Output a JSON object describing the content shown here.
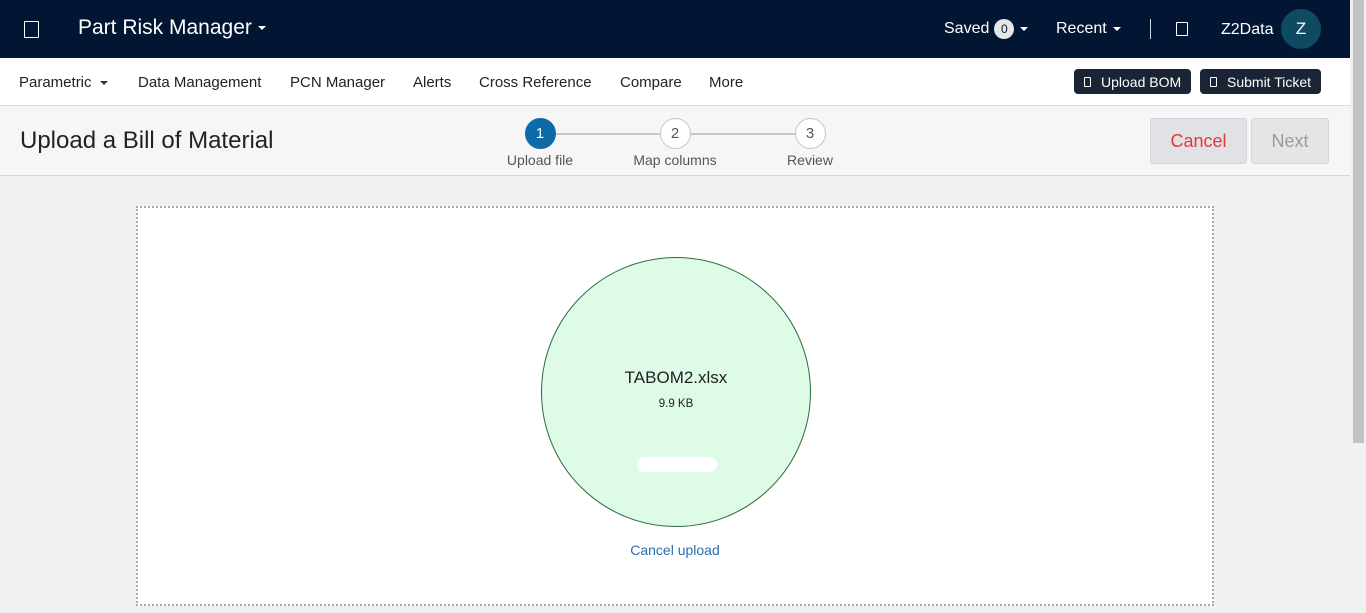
{
  "topbar": {
    "app_title": "Part Risk Manager",
    "saved_label": "Saved",
    "saved_count": "0",
    "recent_label": "Recent",
    "user_name": "Z2Data",
    "avatar_initial": "Z"
  },
  "nav": {
    "items": [
      "Parametric",
      "Data Management",
      "PCN Manager",
      "Alerts",
      "Cross Reference",
      "Compare",
      "More"
    ],
    "upload_bom": "Upload BOM",
    "submit_ticket": "Submit Ticket"
  },
  "page": {
    "title": "Upload a Bill of Material",
    "steps": [
      {
        "number": "1",
        "label": "Upload file"
      },
      {
        "number": "2",
        "label": "Map columns"
      },
      {
        "number": "3",
        "label": "Review"
      }
    ],
    "active_step": 1,
    "cancel_label": "Cancel",
    "next_label": "Next"
  },
  "upload": {
    "file_name": "TABOM2.xlsx",
    "file_size": "9.9 KB",
    "cancel_label": "Cancel upload"
  },
  "colors": {
    "topbar_bg": "#021633",
    "accent": "#0f6aa8",
    "cancel_text": "#e03a3a",
    "file_circle_bg": "#defbe8",
    "link": "#2a6eb3"
  },
  "icons": {
    "menu": "menu-icon",
    "help": "help-icon",
    "upload_bom": "upload-icon",
    "submit_ticket": "ticket-icon"
  }
}
